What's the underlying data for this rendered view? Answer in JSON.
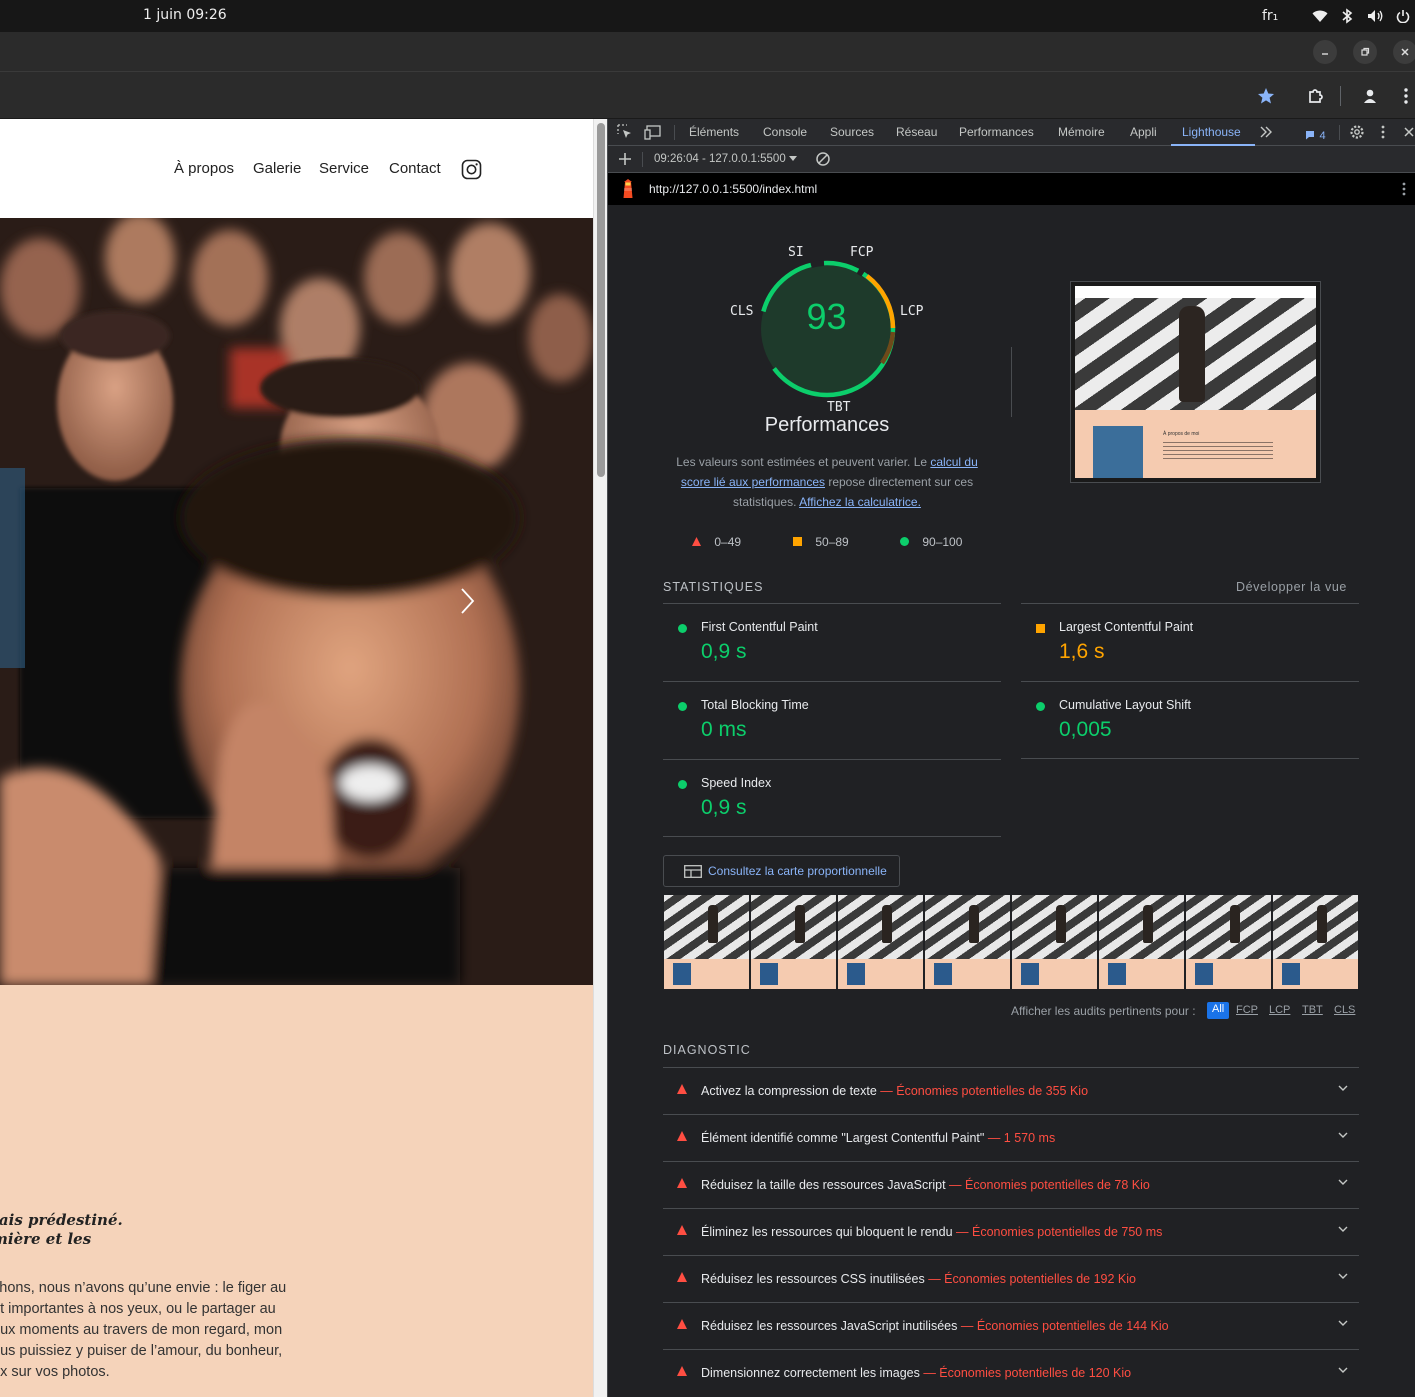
{
  "os": {
    "datetime": "1 juin  09:26",
    "keyboard": "fr₁"
  },
  "site": {
    "nav": [
      "À propos",
      "Galerie",
      "Service",
      "Contact"
    ],
    "quote": "tais prédestiné.\nmière et les",
    "body": "chons, nous n’avons qu’une envie : le figer au\nnt importantes à nos yeux, ou le partager au\neux moments au travers de mon regard, mon\nous puissiez y puiser de l’amour, du bonheur,\nux sur vos photos."
  },
  "devtools": {
    "tabs": [
      "Éléments",
      "Console",
      "Sources",
      "Réseau",
      "Performances",
      "Mémoire",
      "Appli",
      "Lighthouse"
    ],
    "issues_count": "4",
    "report_selector": "09:26:04 - 127.0.0.1:5500",
    "url": "http://127.0.0.1:5500/index.html"
  },
  "lighthouse": {
    "score": "93",
    "gauge_labels": {
      "si": "SI",
      "fcp": "FCP",
      "lcp": "LCP",
      "cls": "CLS",
      "tbt": "TBT"
    },
    "category": "Performances",
    "desc_1": "Les valeurs sont estimées et peuvent varier. Le ",
    "desc_link_1": "calcul du score lié aux performances",
    "desc_2": " repose directement sur ces statistiques. ",
    "desc_link_2": "Affichez la calculatrice.",
    "legend": [
      "0–49",
      "50–89",
      "90–100"
    ],
    "stats_title": "STATISTIQUES",
    "expand_view": "Développer la vue",
    "metrics": [
      {
        "name": "First Contentful Paint",
        "value": "0,9 s",
        "status": "pass"
      },
      {
        "name": "Largest Contentful Paint",
        "value": "1,6 s",
        "status": "average"
      },
      {
        "name": "Total Blocking Time",
        "value": "0 ms",
        "status": "pass"
      },
      {
        "name": "Cumulative Layout Shift",
        "value": "0,005",
        "status": "pass"
      },
      {
        "name": "Speed Index",
        "value": "0,9 s",
        "status": "pass"
      }
    ],
    "treemap_button": "Consultez la carte proportionnelle",
    "filter_label": "Afficher les audits pertinents pour :",
    "filters": [
      "All",
      "FCP",
      "LCP",
      "TBT",
      "CLS"
    ],
    "thumb_about_heading": "À propos de moi",
    "diagnostic_title": "DIAGNOSTIC",
    "audits": [
      {
        "title": "Activez la compression de texte",
        "saving": "— Économies potentielles de 355 Kio"
      },
      {
        "title": "Élément identifié comme \"Largest Contentful Paint\"",
        "saving": "— 1 570 ms"
      },
      {
        "title": "Réduisez la taille des ressources JavaScript",
        "saving": "— Économies potentielles de 78 Kio"
      },
      {
        "title": "Éliminez les ressources qui bloquent le rendu",
        "saving": "— Économies potentielles de 750 ms"
      },
      {
        "title": "Réduisez les ressources CSS inutilisées",
        "saving": "— Économies potentielles de 192 Kio"
      },
      {
        "title": "Réduisez les ressources JavaScript inutilisées",
        "saving": "— Économies potentielles de 144 Kio"
      },
      {
        "title": "Dimensionnez correctement les images",
        "saving": "— Économies potentielles de 120 Kio"
      }
    ]
  },
  "colors": {
    "pass": "#0cce6b",
    "average": "#ffa400",
    "fail": "#ff4e42",
    "link": "#8ab4f8"
  }
}
